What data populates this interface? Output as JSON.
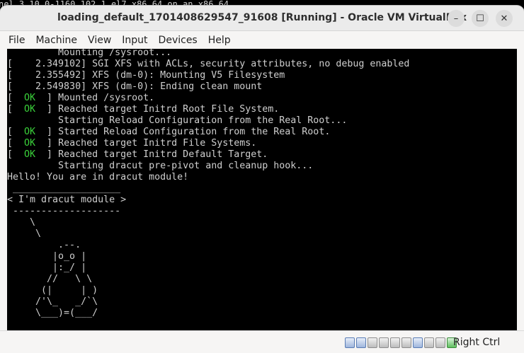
{
  "background": {
    "top_line": "nel 3.10.0-1160.102.1.el7.x86_64 on an x86_64",
    "margin_lines": [
      "ot",
      "ot",
      "ot",
      "",
      "ot"
    ]
  },
  "window": {
    "title": "loading_default_1701408629547_91608 [Running] - Oracle VM VirtualBox",
    "controls": {
      "minimize": "–",
      "maximize": "☐",
      "close": "✕"
    }
  },
  "menubar": {
    "items": [
      {
        "label": "File"
      },
      {
        "label": "Machine"
      },
      {
        "label": "View"
      },
      {
        "label": "Input"
      },
      {
        "label": "Devices"
      },
      {
        "label": "Help"
      }
    ]
  },
  "console": {
    "lines": [
      {
        "prefix": "",
        "ok": "",
        "suffix": "         Mounting /sysroot..."
      },
      {
        "prefix": "[    2.349102] ",
        "ok": "",
        "suffix": "SGI XFS with ACLs, security attributes, no debug enabled"
      },
      {
        "prefix": "[    2.355492] ",
        "ok": "",
        "suffix": "XFS (dm-0): Mounting V5 Filesystem"
      },
      {
        "prefix": "[    2.549830] ",
        "ok": "",
        "suffix": "XFS (dm-0): Ending clean mount"
      },
      {
        "prefix": "[  ",
        "ok": "OK",
        "suffix": "  ] Mounted /sysroot."
      },
      {
        "prefix": "[  ",
        "ok": "OK",
        "suffix": "  ] Reached target Initrd Root File System."
      },
      {
        "prefix": "",
        "ok": "",
        "suffix": "         Starting Reload Configuration from the Real Root..."
      },
      {
        "prefix": "[  ",
        "ok": "OK",
        "suffix": "  ] Started Reload Configuration from the Real Root."
      },
      {
        "prefix": "[  ",
        "ok": "OK",
        "suffix": "  ] Reached target Initrd File Systems."
      },
      {
        "prefix": "[  ",
        "ok": "OK",
        "suffix": "  ] Reached target Initrd Default Target."
      },
      {
        "prefix": "",
        "ok": "",
        "suffix": "         Starting dracut pre-pivot and cleanup hook..."
      },
      {
        "prefix": "",
        "ok": "",
        "suffix": "Hello! You are in dracut module!"
      },
      {
        "prefix": "",
        "ok": "",
        "suffix": " ___________________"
      },
      {
        "prefix": "",
        "ok": "",
        "suffix": "< I'm dracut module >"
      },
      {
        "prefix": "",
        "ok": "",
        "suffix": " -------------------"
      },
      {
        "prefix": "",
        "ok": "",
        "suffix": "    \\"
      },
      {
        "prefix": "",
        "ok": "",
        "suffix": "     \\"
      },
      {
        "prefix": "",
        "ok": "",
        "suffix": "         .--."
      },
      {
        "prefix": "",
        "ok": "",
        "suffix": "        |o_o |"
      },
      {
        "prefix": "",
        "ok": "",
        "suffix": "        |:_/ |"
      },
      {
        "prefix": "",
        "ok": "",
        "suffix": "       //   \\ \\"
      },
      {
        "prefix": "",
        "ok": "",
        "suffix": "      (|     | )"
      },
      {
        "prefix": "",
        "ok": "",
        "suffix": "     /'\\_   _/`\\"
      },
      {
        "prefix": "",
        "ok": "",
        "suffix": "     \\___)=(___/"
      }
    ]
  },
  "statusbar": {
    "icons": [
      "hard-disk-icon",
      "optical-drive-icon",
      "audio-icon",
      "network-icon",
      "usb-icon",
      "shared-folders-icon",
      "display-icon",
      "video-capture-icon",
      "mouse-integration-icon",
      "green-arrow-icon"
    ],
    "host_key": "Right Ctrl"
  }
}
